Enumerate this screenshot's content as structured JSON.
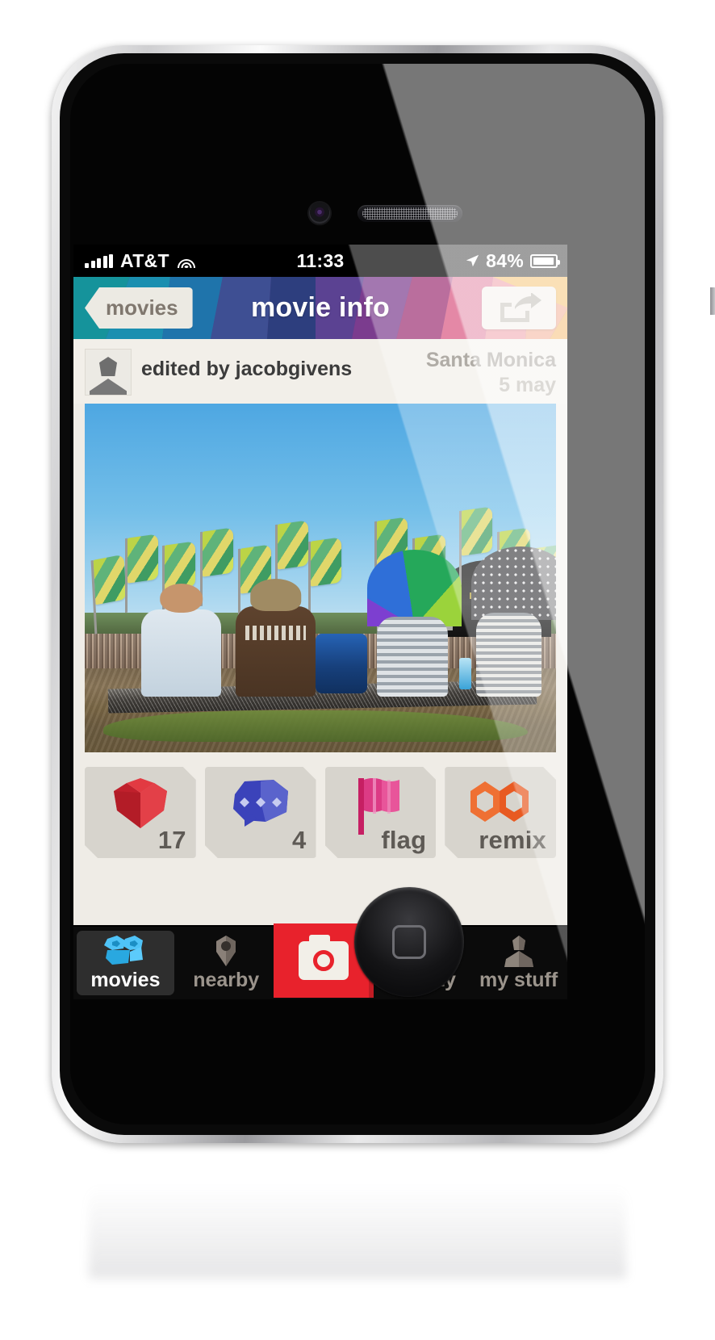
{
  "status_bar": {
    "carrier": "AT&T",
    "signal_icon": "signal-bars-icon",
    "wifi_icon": "wifi-icon",
    "clock": "11:33",
    "location_icon": "location-arrow-icon",
    "battery_percent": "84%",
    "battery_icon": "battery-icon"
  },
  "nav_bar": {
    "back_label": "movies",
    "title": "movie info",
    "share_icon": "share-icon"
  },
  "meta": {
    "avatar_icon": "user-avatar-icon",
    "edited_by": "edited by jacobgivens",
    "location": "Santa Monica",
    "date": "5 may"
  },
  "photo": {
    "alt": "festival-crowd-photo"
  },
  "actions": [
    {
      "name": "like-button",
      "icon": "heart-icon",
      "label": "17",
      "icon_color": "#cf2230"
    },
    {
      "name": "comment-button",
      "icon": "speech-bubble-icon",
      "label": "4",
      "icon_color": "#3d4fc4"
    },
    {
      "name": "flag-button",
      "icon": "flag-icon",
      "label": "flag",
      "icon_color": "#e03d86"
    },
    {
      "name": "remix-button",
      "icon": "remix-icon",
      "label": "remix",
      "icon_color": "#f06424"
    }
  ],
  "tab_bar": {
    "items": [
      {
        "name": "tab-movies",
        "label": "movies",
        "icon": "movie-camera-icon",
        "active": true
      },
      {
        "name": "tab-nearby",
        "label": "nearby",
        "icon": "map-pin-icon",
        "active": false
      },
      {
        "name": "tab-camera",
        "label": "",
        "icon": "camera-icon",
        "active": false
      },
      {
        "name": "tab-activity",
        "label": "activity",
        "icon": "list-icon",
        "active": false
      },
      {
        "name": "tab-my-stuff",
        "label": "my stuff",
        "icon": "person-icon",
        "active": false
      }
    ]
  },
  "theme": {
    "accent_red": "#e8222c",
    "screen_bg": "#efece6",
    "tabbar_bg": "#0b0b0b"
  }
}
